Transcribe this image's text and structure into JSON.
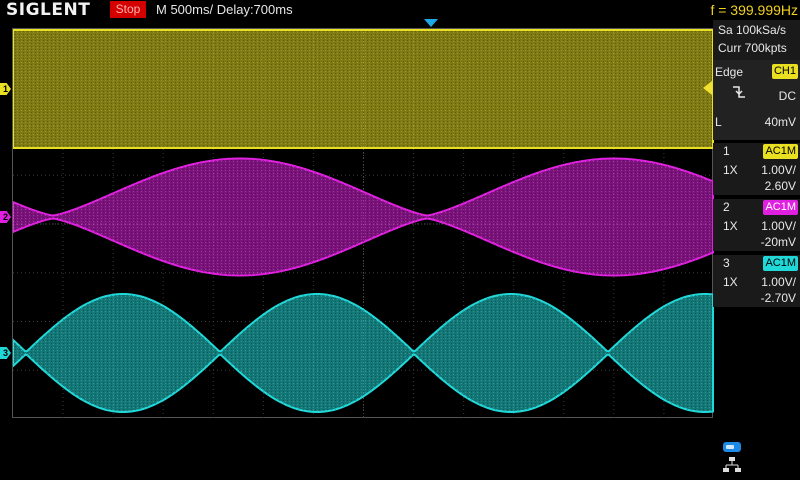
{
  "brand": "SIGLENT",
  "run_state": "Stop",
  "timebase": "M 500ms/",
  "delay": "Delay:700ms",
  "frequency": "f = 399.999Hz",
  "acquisition": {
    "sample_rate": "Sa 100kSa/s",
    "memory": "Curr 700kpts"
  },
  "trigger": {
    "type": "Edge",
    "source": "CH1",
    "slope_icon": "falling-edge-icon",
    "coupling": "DC",
    "level_label": "L",
    "level": "40mV"
  },
  "channels": [
    {
      "num": "1",
      "coupling": "AC1M",
      "probe": "1X",
      "scale": "1.00V/",
      "offset": "2.60V",
      "color": "#e8e020"
    },
    {
      "num": "2",
      "coupling": "AC1M",
      "probe": "1X",
      "scale": "1.00V/",
      "offset": "-20mV",
      "color": "#e020e0"
    },
    {
      "num": "3",
      "coupling": "AC1M",
      "probe": "1X",
      "scale": "1.00V/",
      "offset": "-2.70V",
      "color": "#20d8d8"
    }
  ],
  "colors": {
    "ch1": "#e8e020",
    "ch2": "#e020e0",
    "ch3": "#20d8d8",
    "stop": "#d40000",
    "trigger_marker": "#1ea8e8"
  },
  "icons": [
    "usb-icon",
    "network-icon"
  ]
}
